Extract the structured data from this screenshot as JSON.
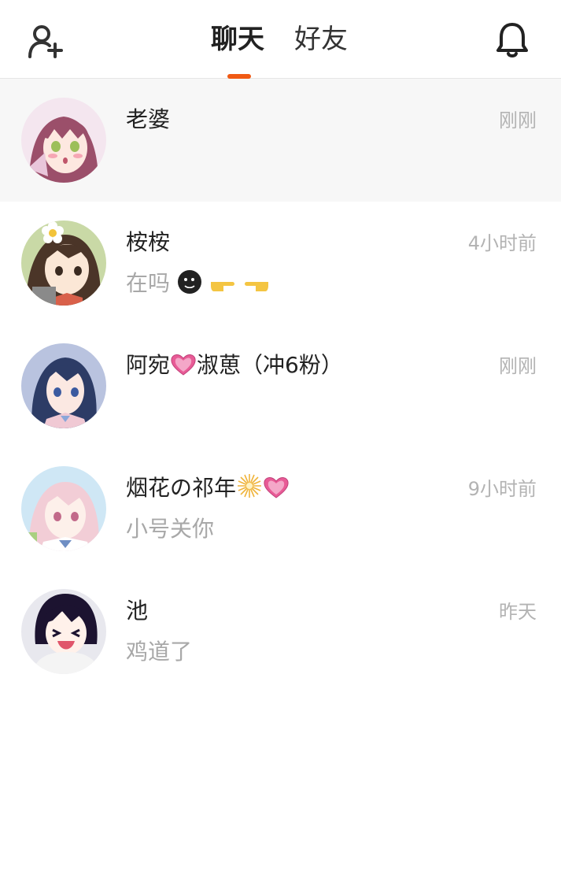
{
  "header": {
    "add_friend_icon": "add-user-icon",
    "bell_icon": "bell-icon",
    "tabs": [
      {
        "label": "聊天",
        "active": true
      },
      {
        "label": "好友",
        "active": false
      }
    ],
    "accent_color": "#f05a14"
  },
  "conversations": [
    {
      "name": "老婆",
      "preview": "",
      "time": "刚刚",
      "selected": true
    },
    {
      "name": "桉桉",
      "preview": "在吗",
      "preview_emoji": [
        "moon-face-icon",
        "pointing-right-icon",
        "pointing-left-icon"
      ],
      "time": "4小时前"
    },
    {
      "name_prefix": "阿宛",
      "name_suffix": "淑葸（冲6粉）",
      "name_emoji": [
        "pink-heart-icon"
      ],
      "preview": "",
      "time": "刚刚"
    },
    {
      "name": "烟花の祁年",
      "name_emoji": [
        "sparkler-icon",
        "pink-heart-icon"
      ],
      "preview": "小号关你",
      "time": "9小时前"
    },
    {
      "name": "池",
      "preview": "鸡道了",
      "time": "昨天"
    }
  ]
}
